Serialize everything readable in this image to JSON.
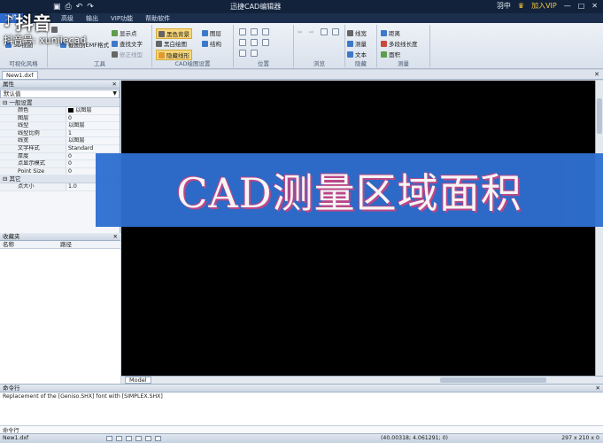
{
  "titlebar": {
    "title": "迅捷CAD编辑器",
    "user": "羽中",
    "vip": "加入VIP",
    "window_controls": [
      "minimize-icon",
      "maximize-icon",
      "close-icon"
    ]
  },
  "menu": {
    "file_tab": "文件",
    "tabs": [
      "高级",
      "输出",
      "VIP功能",
      "帮助软件"
    ]
  },
  "watermark": {
    "brand": "抖音",
    "id_line": "抖音号: xunjiecad"
  },
  "ribbon": {
    "groups": [
      {
        "label": "可视化风格",
        "items": [
          "3D视图"
        ]
      },
      {
        "label": "工具",
        "items": [
          "截图到EMF格式",
          "显示点",
          "查找文字",
          "修正线型"
        ]
      },
      {
        "label": "CAD绘图设置",
        "items": [
          "黑色背景",
          "黑白绘图",
          "隐藏线形",
          "图层",
          "结构"
        ]
      },
      {
        "label": "位置",
        "items": []
      },
      {
        "label": "浏览",
        "items": []
      },
      {
        "label": "隐藏",
        "items": [
          "线宽",
          "测量",
          "文本"
        ]
      },
      {
        "label": "测量",
        "items": [
          "距离",
          "多段线长度",
          "面积"
        ]
      }
    ]
  },
  "document": {
    "tab": "New1.dxf"
  },
  "properties_panel": {
    "header": "属性",
    "combo_value": "默认值",
    "group_general": "一般设置",
    "rows": [
      {
        "key": "颜色",
        "value": "以图层"
      },
      {
        "key": "图层",
        "value": "0"
      },
      {
        "key": "线型",
        "value": "以图层"
      },
      {
        "key": "线型比例",
        "value": "1"
      },
      {
        "key": "线宽",
        "value": "以图层"
      },
      {
        "key": "文字样式",
        "value": "Standard"
      },
      {
        "key": "厚度",
        "value": "0"
      },
      {
        "key": "点显示模式",
        "value": "0"
      },
      {
        "key": "Point Size",
        "value": "0"
      }
    ],
    "group_other": "其它",
    "rows_other": [
      {
        "key": "点大小",
        "value": "1.0"
      }
    ]
  },
  "favorites_panel": {
    "header": "收藏夹",
    "columns": [
      "名称",
      "路径"
    ]
  },
  "canvas": {
    "model_tab": "Model"
  },
  "banner": {
    "text": "CAD测量区域面积"
  },
  "command": {
    "header": "命令行",
    "lines": [
      "Replacement of the [Geniso.SHX] font with [SIMPLEX.SHX]"
    ],
    "input_label": "命令行"
  },
  "status": {
    "file": "New1.dxf",
    "coords": "(40.00318; 4.061291; 0)",
    "dims": "297 x 210 x 0"
  }
}
